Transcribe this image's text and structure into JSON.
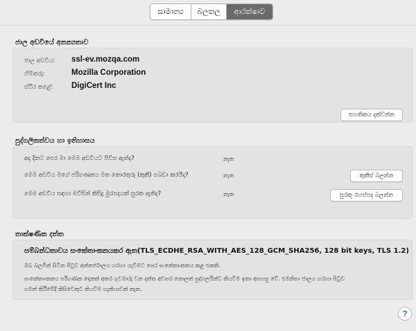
{
  "tabs": [
    {
      "label": "සාමාන්‍ය"
    },
    {
      "label": "බලතල"
    },
    {
      "label": "ආරක්ෂාව",
      "active": true
    }
  ],
  "identity": {
    "title": "ජාල අඩවියේ අනන්‍යතාව",
    "rows": [
      {
        "label": "ජාල අඩවිය:",
        "value": "ssl-ev.mozqa.com"
      },
      {
        "label": "හිමිකරු:",
        "value": "Mozilla Corporation"
      },
      {
        "label": "ස්ථිර කළේ:",
        "value": "DigiCert Inc"
      }
    ],
    "view_cert_button": "සහතිකය දක්වන්න"
  },
  "privacy": {
    "title": "පුද්ගලිකත්වය හා ඉතිහාසය",
    "rows": [
      {
        "question": "අද දිනට පෙර මා මෙම අඩවියට පිවිස ඇත්ද?",
        "answer": "නැත",
        "button": ""
      },
      {
        "question": "මෙම අඩවිය මගේ පරිගණකය මත තොරතුරු (කුකී) ගබඩා කරයිද?",
        "answer": "නැත",
        "button": "කුකීස් බලන්න"
      },
      {
        "question": "මෙම අඩවිය සඳහා මවිසින් කිසිදු මුරපදයක් සුරක ඇතිද?",
        "answer": "නැත",
        "button": "සුරකූ රහස්පද බලන්න"
      }
    ]
  },
  "technical": {
    "title": "තාක්ෂණික දත්ත",
    "heading": "සම්බන්ධතාවය සංකේතාංකනයකර ඇත(TLS_ECDHE_RSA_WITH_AES_128_GCM_SHA256, 128 bit keys, TLS 1.2)",
    "line1": "ඔබ බලමින් සිටින පිටුව අන්තර්ජාලය හරහා යැවීමට පෙර සංකේතාංකනය කළ එකකි.",
    "line2": "සංකේතාංකනය පරිගණක දෙකක් අතර ගුවමාරු වන දත්ත අවසර නොලත් පුද්ගලයින්ට කියවීම ඉතා අපහසු වේ. එමනිසා ජාලය හරහා පිටුව",
    "line3": "ගමන් කිරීමේදී කිසිවෙකුට කියවීම හැකියාවක් නැත."
  },
  "help": {
    "label": "?"
  }
}
